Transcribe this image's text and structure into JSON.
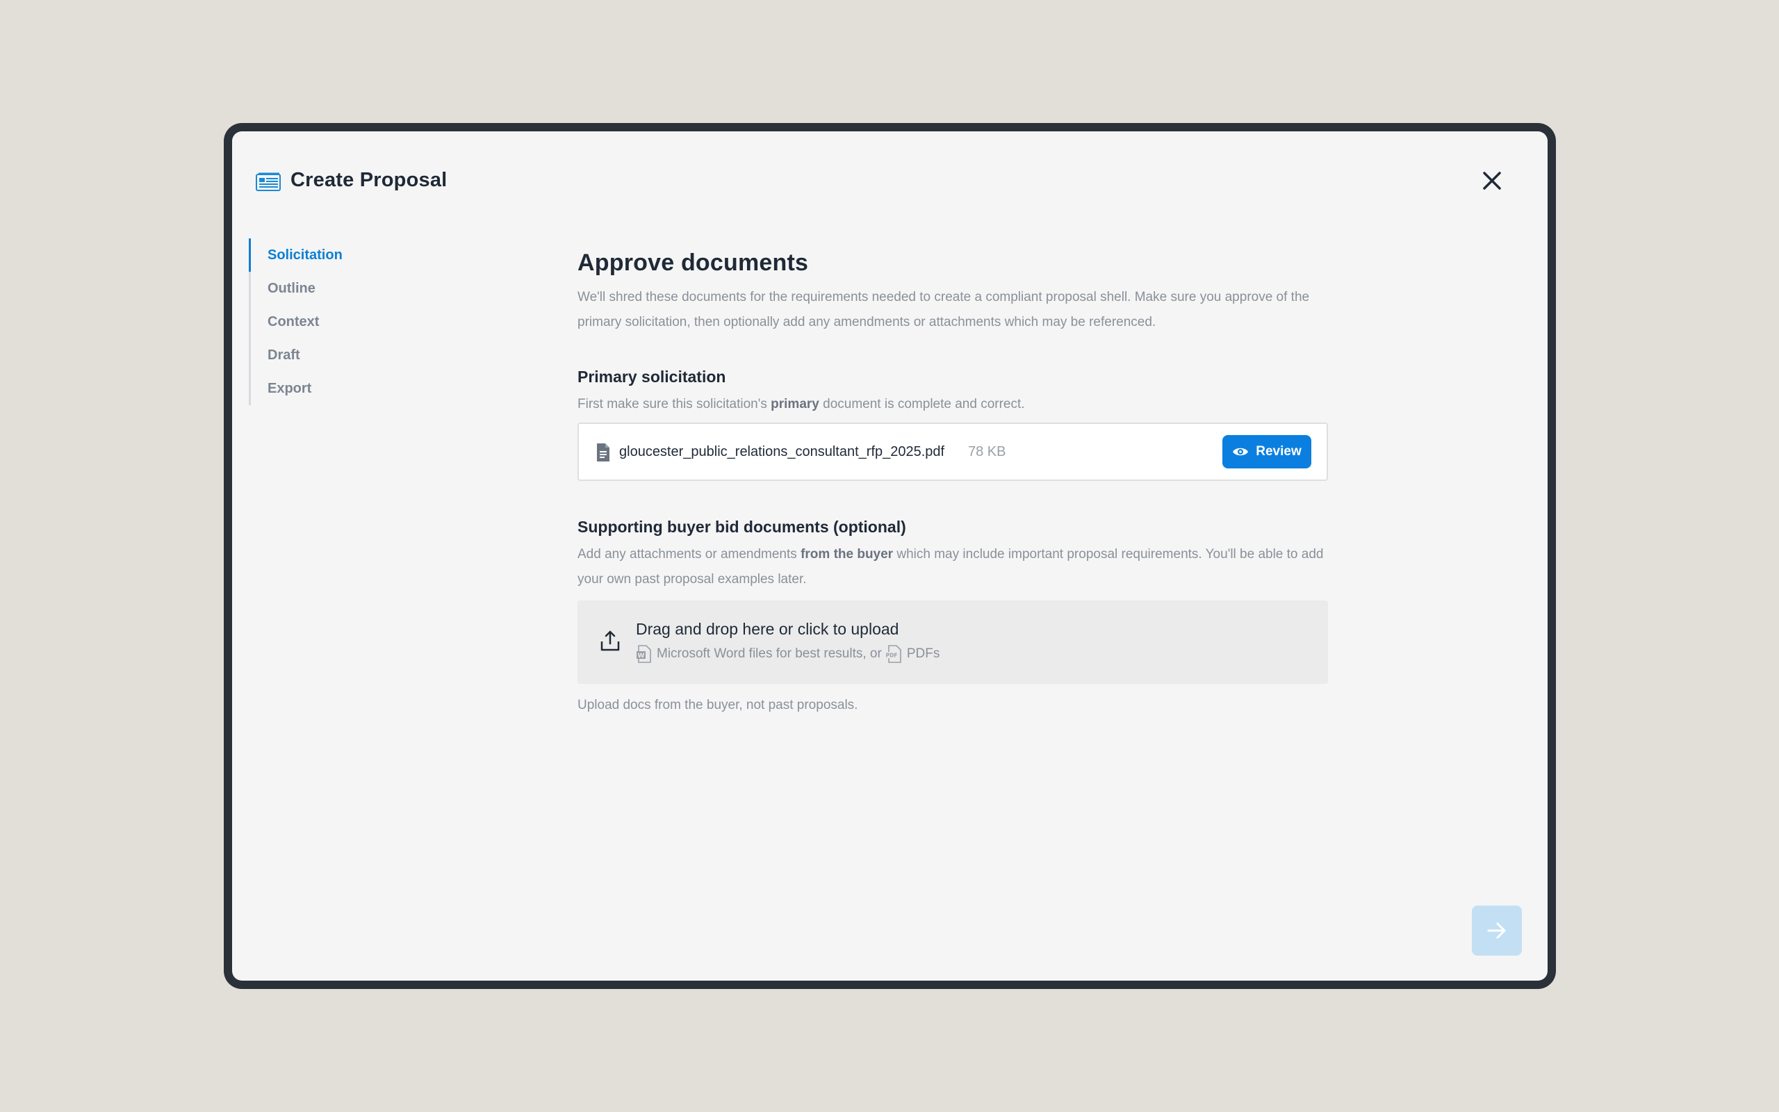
{
  "header": {
    "title": "Create Proposal",
    "logo_icon": "proposal-doc-icon",
    "close_icon": "close-icon"
  },
  "sidebar": {
    "items": [
      {
        "label": "Solicitation",
        "active": true
      },
      {
        "label": "Outline",
        "active": false
      },
      {
        "label": "Context",
        "active": false
      },
      {
        "label": "Draft",
        "active": false
      },
      {
        "label": "Export",
        "active": false
      }
    ]
  },
  "main": {
    "title": "Approve documents",
    "description": "We'll shred these documents for the requirements needed to create a compliant proposal shell. Make sure you approve of the primary solicitation, then optionally add any amendments or attachments which may be referenced."
  },
  "primary": {
    "heading": "Primary solicitation",
    "sub_before": "First make sure this solicitation's ",
    "sub_bold": "primary",
    "sub_after": " document is complete and correct.",
    "file_name": "gloucester_public_relations_consultant_rfp_2025.pdf",
    "file_size": "78 KB",
    "review_label": "Review"
  },
  "supporting": {
    "heading": "Supporting buyer bid documents (optional)",
    "sub_before": "Add any attachments or amendments ",
    "sub_bold": "from the buyer",
    "sub_after": " which may include important proposal requirements. You'll be able to add your own past proposal examples later.",
    "dropzone_title": "Drag and drop here or click to upload",
    "hint_word": "Microsoft Word files for best results, or",
    "hint_pdf": "PDFs",
    "note": "Upload docs from the buyer, not past proposals."
  },
  "colors": {
    "accent": "#0b7fe0",
    "frame": "#2a3138",
    "background": "#e2dfd8"
  }
}
